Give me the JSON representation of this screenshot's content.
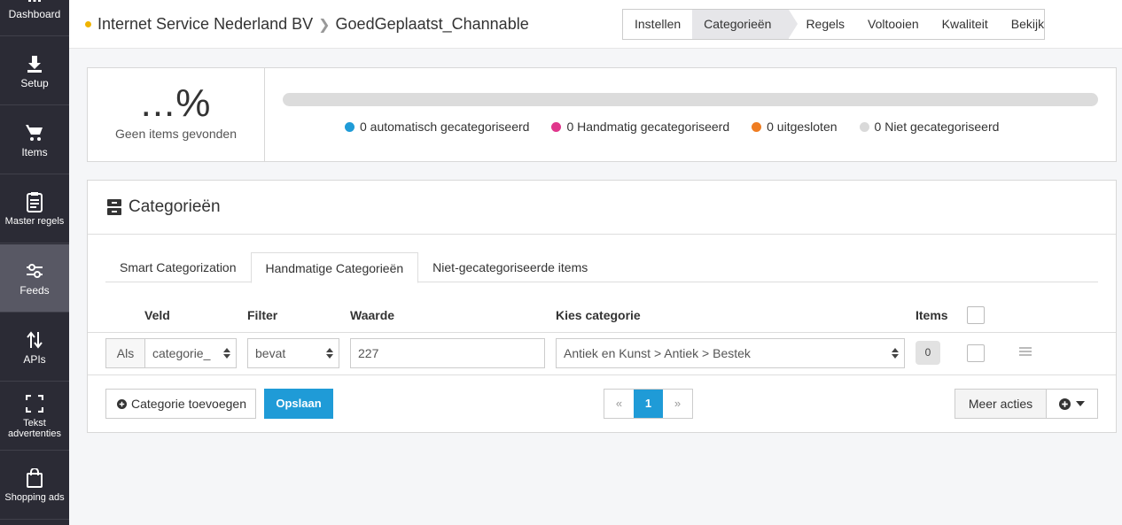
{
  "sidebar": {
    "items": [
      {
        "label": "Dashboard",
        "icon": "dashboard-icon"
      },
      {
        "label": "Setup",
        "icon": "download-icon"
      },
      {
        "label": "Items",
        "icon": "cart-icon"
      },
      {
        "label": "Master regels",
        "icon": "clipboard-icon"
      },
      {
        "label": "Feeds",
        "icon": "sliders-icon"
      },
      {
        "label": "APIs",
        "icon": "arrows-updown-icon"
      },
      {
        "label": "Tekst advertenties",
        "icon": "expand-icon"
      },
      {
        "label": "Shopping ads",
        "icon": "bag-icon"
      }
    ],
    "active_index": 4
  },
  "header": {
    "breadcrumb": [
      "Internet Service Nederland BV",
      "GoedGeplaatst_Channable"
    ],
    "status_color": "#f0b400",
    "steps": [
      "Instellen",
      "Categorieën",
      "Regels",
      "Voltooien",
      "Kwaliteit",
      "Bekijk"
    ],
    "active_step": 1
  },
  "stats": {
    "percent": "...%",
    "no_items": "Geen items gevonden",
    "legend": [
      {
        "label": "0 automatisch gecategoriseerd",
        "color": "#1f9bd7"
      },
      {
        "label": "0 Handmatig gecategoriseerd",
        "color": "#e0368c"
      },
      {
        "label": "0 uitgesloten",
        "color": "#ef7d22"
      },
      {
        "label": "0 Niet gecategoriseerd",
        "color": "#d9d9d9"
      }
    ]
  },
  "categories": {
    "title": "Categorieën",
    "tabs": [
      "Smart Categorization",
      "Handmatige Categorieën",
      "Niet-gecategoriseerde items"
    ],
    "active_tab": 1,
    "columns": {
      "veld": "Veld",
      "filter": "Filter",
      "waarde": "Waarde",
      "kies": "Kies categorie",
      "items": "Items"
    },
    "row": {
      "prefix": "Als",
      "veld": "categorie_",
      "filter": "bevat",
      "waarde": "227",
      "categorie": "Antiek en Kunst > Antiek > Bestek",
      "items": "0"
    },
    "add_button": "Categorie toevoegen",
    "save_button": "Opslaan",
    "pager": {
      "prev": "«",
      "current": "1",
      "next": "»"
    },
    "more_actions": "Meer acties"
  }
}
